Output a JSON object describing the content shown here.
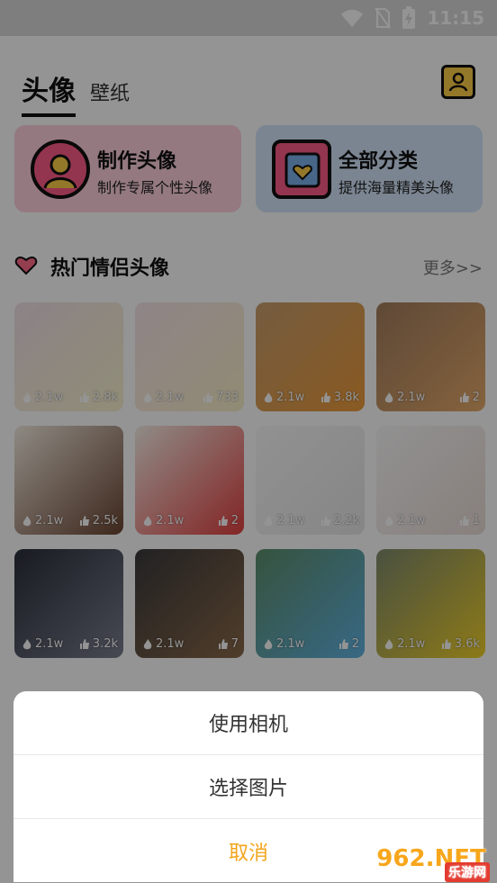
{
  "status_bar": {
    "time": "11:15",
    "icons": [
      "wifi-icon",
      "no-sim-icon",
      "battery-charging-icon"
    ]
  },
  "tabs": [
    {
      "label": "头像",
      "active": true
    },
    {
      "label": "壁纸",
      "active": false
    }
  ],
  "header": {
    "right_icon": "contacts-icon"
  },
  "banners": [
    {
      "title": "制作头像",
      "subtitle": "制作专属个性头像",
      "icon": "user-avatar-icon"
    },
    {
      "title": "全部分类",
      "subtitle": "提供海量精美头像",
      "icon": "category-cards-icon"
    }
  ],
  "hot_section": {
    "title": "热门情侣头像",
    "more": "更多>>",
    "icon": "heart-icon"
  },
  "grid": [
    {
      "likes": "2.1w",
      "thumbs": "2.8k",
      "colors": [
        "#f1e1e8",
        "#f9f3cd"
      ]
    },
    {
      "likes": "2.1w",
      "thumbs": "733",
      "colors": [
        "#f7e4e9",
        "#f8f0c8"
      ]
    },
    {
      "likes": "2.1w",
      "thumbs": "3.8k",
      "colors": [
        "#c8a06e",
        "#ee9b3b"
      ]
    },
    {
      "likes": "2.1w",
      "thumbs": "2",
      "colors": [
        "#a37e5f",
        "#e5aa6b"
      ]
    },
    {
      "likes": "2.1w",
      "thumbs": "2.5k",
      "colors": [
        "#f4ede2",
        "#6b4431"
      ]
    },
    {
      "likes": "2.1w",
      "thumbs": "2",
      "colors": [
        "#f7f0e8",
        "#e24040"
      ]
    },
    {
      "likes": "2.1w",
      "thumbs": "2.2k",
      "colors": [
        "#fafafa",
        "#e7e7e7"
      ]
    },
    {
      "likes": "2.1w",
      "thumbs": "1",
      "colors": [
        "#fafafa",
        "#eadcd6"
      ]
    },
    {
      "likes": "2.1w",
      "thumbs": "3.2k",
      "colors": [
        "#2b2f3a",
        "#7b8090"
      ]
    },
    {
      "likes": "2.1w",
      "thumbs": "7",
      "colors": [
        "#3b3a3c",
        "#8b6a4a"
      ]
    },
    {
      "likes": "2.1w",
      "thumbs": "2",
      "colors": [
        "#5e8f6b",
        "#61b4e4"
      ]
    },
    {
      "likes": "2.1w",
      "thumbs": "3.6k",
      "colors": [
        "#7f8c6f",
        "#f2d22a"
      ]
    }
  ],
  "action_sheet": {
    "items": [
      "使用相机",
      "选择图片"
    ],
    "cancel": "取消"
  },
  "watermark": {
    "brand": "962.NET",
    "sub": "乐游网"
  },
  "colors": {
    "accent": "#f3a51b",
    "pink_banner": "#ffd1de",
    "blue_banner": "#d5e6fb"
  }
}
